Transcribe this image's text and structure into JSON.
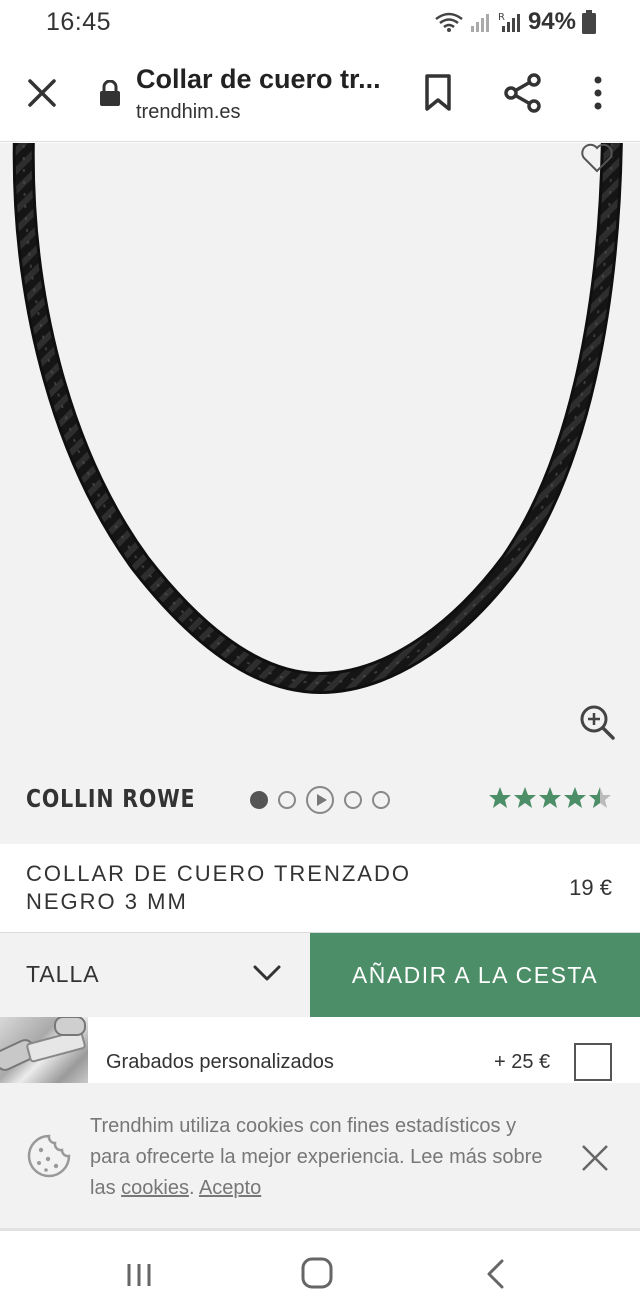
{
  "status_bar": {
    "time": "16:45",
    "battery": "94%"
  },
  "browser": {
    "title": "Collar de cuero tr...",
    "url": "trendhim.es"
  },
  "product": {
    "brand": "COLLIN ROWE",
    "name": "COLLAR DE CUERO TRENZADO NEGRO 3 MM",
    "price": "19 €",
    "rating": 4.5,
    "gallery_images": 5,
    "gallery_active_index": 0
  },
  "purchase": {
    "size_label": "TALLA",
    "add_to_cart_label": "AÑADIR A LA CESTA",
    "accent_color": "#4b8e67"
  },
  "engraving": {
    "label": "Grabados personalizados",
    "price": "+ 25 €"
  },
  "cookie_banner": {
    "text_before": "Trendhim utiliza cookies con fines estadísticos y para ofrecerte la mejor experiencia. Lee más sobre las ",
    "link_cookies": "cookies",
    "text_middle": ". ",
    "link_accept": "Acepto"
  }
}
